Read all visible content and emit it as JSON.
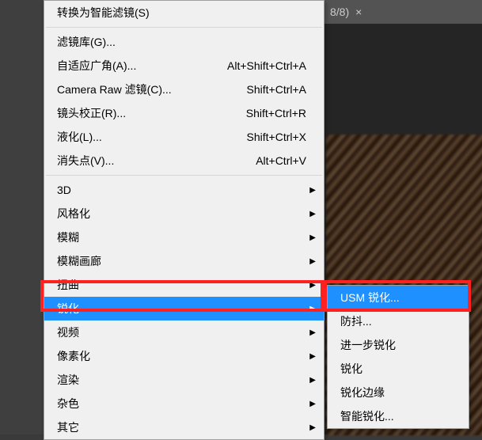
{
  "tab": {
    "label": "8/8)",
    "close": "×"
  },
  "menu": {
    "group1": [
      {
        "label": "转换为智能滤镜(S)",
        "shortcut": ""
      }
    ],
    "group2": [
      {
        "label": "滤镜库(G)...",
        "shortcut": ""
      },
      {
        "label": "自适应广角(A)...",
        "shortcut": "Alt+Shift+Ctrl+A"
      },
      {
        "label": "Camera Raw 滤镜(C)...",
        "shortcut": "Shift+Ctrl+A"
      },
      {
        "label": "镜头校正(R)...",
        "shortcut": "Shift+Ctrl+R"
      },
      {
        "label": "液化(L)...",
        "shortcut": "Shift+Ctrl+X"
      },
      {
        "label": "消失点(V)...",
        "shortcut": "Alt+Ctrl+V"
      }
    ],
    "group3": [
      {
        "label": "3D",
        "submenu": true
      },
      {
        "label": "风格化",
        "submenu": true
      },
      {
        "label": "模糊",
        "submenu": true
      },
      {
        "label": "模糊画廊",
        "submenu": true
      },
      {
        "label": "扭曲",
        "submenu": true
      },
      {
        "label": "锐化",
        "submenu": true,
        "selected": true
      },
      {
        "label": "视频",
        "submenu": true
      },
      {
        "label": "像素化",
        "submenu": true
      },
      {
        "label": "渲染",
        "submenu": true
      },
      {
        "label": "杂色",
        "submenu": true
      },
      {
        "label": "其它",
        "submenu": true
      }
    ]
  },
  "submenu": {
    "items": [
      {
        "label": "USM 锐化...",
        "selected": true
      },
      {
        "label": "防抖...",
        "selected": false
      },
      {
        "label": "进一步锐化",
        "selected": false
      },
      {
        "label": "锐化",
        "selected": false
      },
      {
        "label": "锐化边缘",
        "selected": false
      },
      {
        "label": "智能锐化...",
        "selected": false
      }
    ]
  }
}
